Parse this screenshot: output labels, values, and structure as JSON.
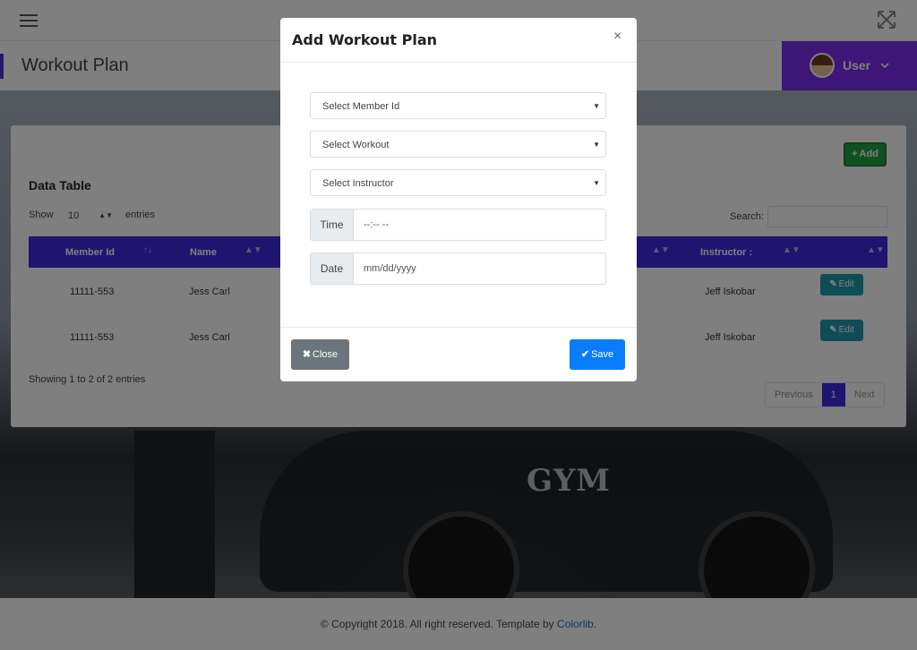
{
  "topbar": {
    "menu_icon": "hamburger-icon",
    "fullscreen_icon": "expand-icon"
  },
  "header": {
    "page_title": "Workout Plan",
    "user_name": "User"
  },
  "panel": {
    "add_label": "Add",
    "table_title": "Data Table",
    "show_label": "Show",
    "page_size": "10",
    "entries_label": "entries",
    "search_label": "Search:",
    "columns": [
      "Member Id",
      "Name",
      "Instructor :"
    ],
    "rows": [
      {
        "member_id": "11111-553",
        "name": "Jess Carl",
        "instructor": "Jeff Iskobar",
        "edit_label": "Edit"
      },
      {
        "member_id": "11111-553",
        "name": "Jess Carl",
        "instructor": "Jeff Iskobar",
        "edit_label": "Edit"
      }
    ],
    "info": "Showing 1 to 2 of 2 entries",
    "pager": {
      "previous": "Previous",
      "current": "1",
      "next": "Next"
    }
  },
  "footer": {
    "text": "© Copyright 2018. All right reserved. Template by",
    "link": "Colorlib"
  },
  "modal": {
    "title": "Add Workout Plan",
    "close_x": "×",
    "select_member": "Select Member Id",
    "select_workout": "Select Workout",
    "select_instructor": "Select Instructor",
    "time_label": "Time",
    "time_value": "--:-- --",
    "date_label": "Date",
    "date_value": "mm/dd/yyyy",
    "close_label": "Close",
    "save_label": "Save"
  },
  "colors": {
    "accent": "#3f2be0",
    "user_bg": "#7a2cf0",
    "save": "#0a7cff",
    "close": "#6c757d",
    "add": "#22a045",
    "edit": "#1f9bab"
  }
}
